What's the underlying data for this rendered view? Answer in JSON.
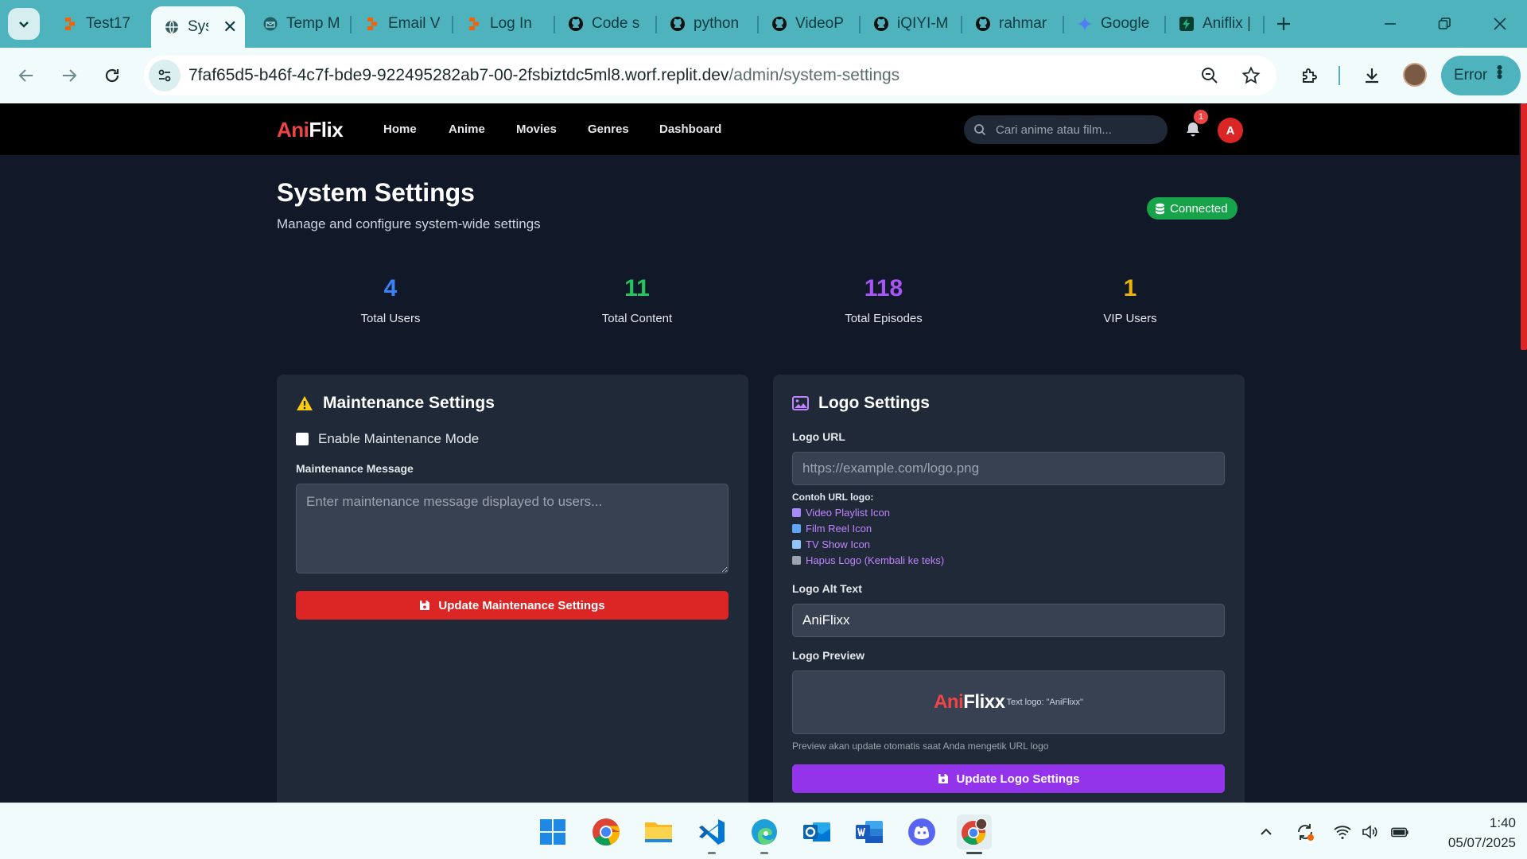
{
  "browser": {
    "tabs": [
      {
        "label": "Test17",
        "favicon": "replit-icon",
        "color": "#f26207"
      },
      {
        "label": "Sys",
        "favicon": "globe-icon",
        "color": "#3a5d61",
        "active": true
      },
      {
        "label": "Temp M",
        "favicon": "temp-mail-icon",
        "color": "#1f5f66"
      },
      {
        "label": "Email V",
        "favicon": "replit-icon",
        "color": "#f26207"
      },
      {
        "label": "Log In",
        "favicon": "replit-icon",
        "color": "#f26207"
      },
      {
        "label": "Code s",
        "favicon": "github-icon",
        "color": "#111111"
      },
      {
        "label": "python",
        "favicon": "github-icon",
        "color": "#111111"
      },
      {
        "label": "VideoP",
        "favicon": "github-icon",
        "color": "#111111"
      },
      {
        "label": "iQIYI-M",
        "favicon": "github-icon",
        "color": "#111111"
      },
      {
        "label": "rahmar",
        "favicon": "github-icon",
        "color": "#111111"
      },
      {
        "label": "Google",
        "favicon": "gemini-icon",
        "color": "#4f7df3"
      },
      {
        "label": "Aniflix |",
        "favicon": "aniflix-icon",
        "color": "#10b981"
      }
    ],
    "address": {
      "domain": "7faf65d5-b46f-4c7f-bde9-922495282ab7-00-2fsbiztdc5ml8.worf.replit.dev",
      "path": "/admin/system-settings"
    },
    "error_label": "Error"
  },
  "app": {
    "brand_a": "Ani",
    "brand_b": "Flix",
    "nav": [
      "Home",
      "Anime",
      "Movies",
      "Genres",
      "Dashboard"
    ],
    "search_placeholder": "Cari anime atau film...",
    "notification_count": "1",
    "avatar_initial": "A"
  },
  "page": {
    "title": "System Settings",
    "subtitle": "Manage and configure system-wide settings",
    "status": "Connected"
  },
  "stats": [
    {
      "value": "4",
      "label": "Total Users",
      "color": "#3b82f6"
    },
    {
      "value": "11",
      "label": "Total Content",
      "color": "#22c55e"
    },
    {
      "value": "118",
      "label": "Total Episodes",
      "color": "#a855f7"
    },
    {
      "value": "1",
      "label": "VIP Users",
      "color": "#eab308"
    }
  ],
  "maintenance": {
    "title": "Maintenance Settings",
    "checkbox_label": "Enable Maintenance Mode",
    "message_label": "Maintenance Message",
    "message_placeholder": "Enter maintenance message displayed to users...",
    "button": "Update Maintenance Settings"
  },
  "logo": {
    "title": "Logo Settings",
    "url_label": "Logo URL",
    "url_placeholder": "https://example.com/logo.png",
    "examples_title": "Contoh URL logo:",
    "examples": [
      {
        "label": "Video Playlist Icon",
        "color": "#a78bfa"
      },
      {
        "label": "Film Reel Icon",
        "color": "#60a5fa"
      },
      {
        "label": "TV Show Icon",
        "color": "#93c5fd"
      },
      {
        "label": "Hapus Logo (Kembali ke teks)",
        "color": "#9ca3af"
      }
    ],
    "alt_label": "Logo Alt Text",
    "alt_value": "AniFlixx",
    "preview_label": "Logo Preview",
    "preview_a": "Ani",
    "preview_b": "Flixx",
    "preview_note": "Text logo: \"AniFlixx\"",
    "preview_hint": "Preview akan update otomatis saat Anda mengetik URL logo",
    "button": "Update Logo Settings"
  },
  "taskbar": {
    "apps": [
      "windows-start-icon",
      "chrome-icon",
      "file-explorer-icon",
      "vscode-icon",
      "edge-icon",
      "outlook-icon",
      "word-icon",
      "discord-icon",
      "chrome-profile-icon"
    ],
    "time": "1:40",
    "date": "05/07/2025"
  }
}
